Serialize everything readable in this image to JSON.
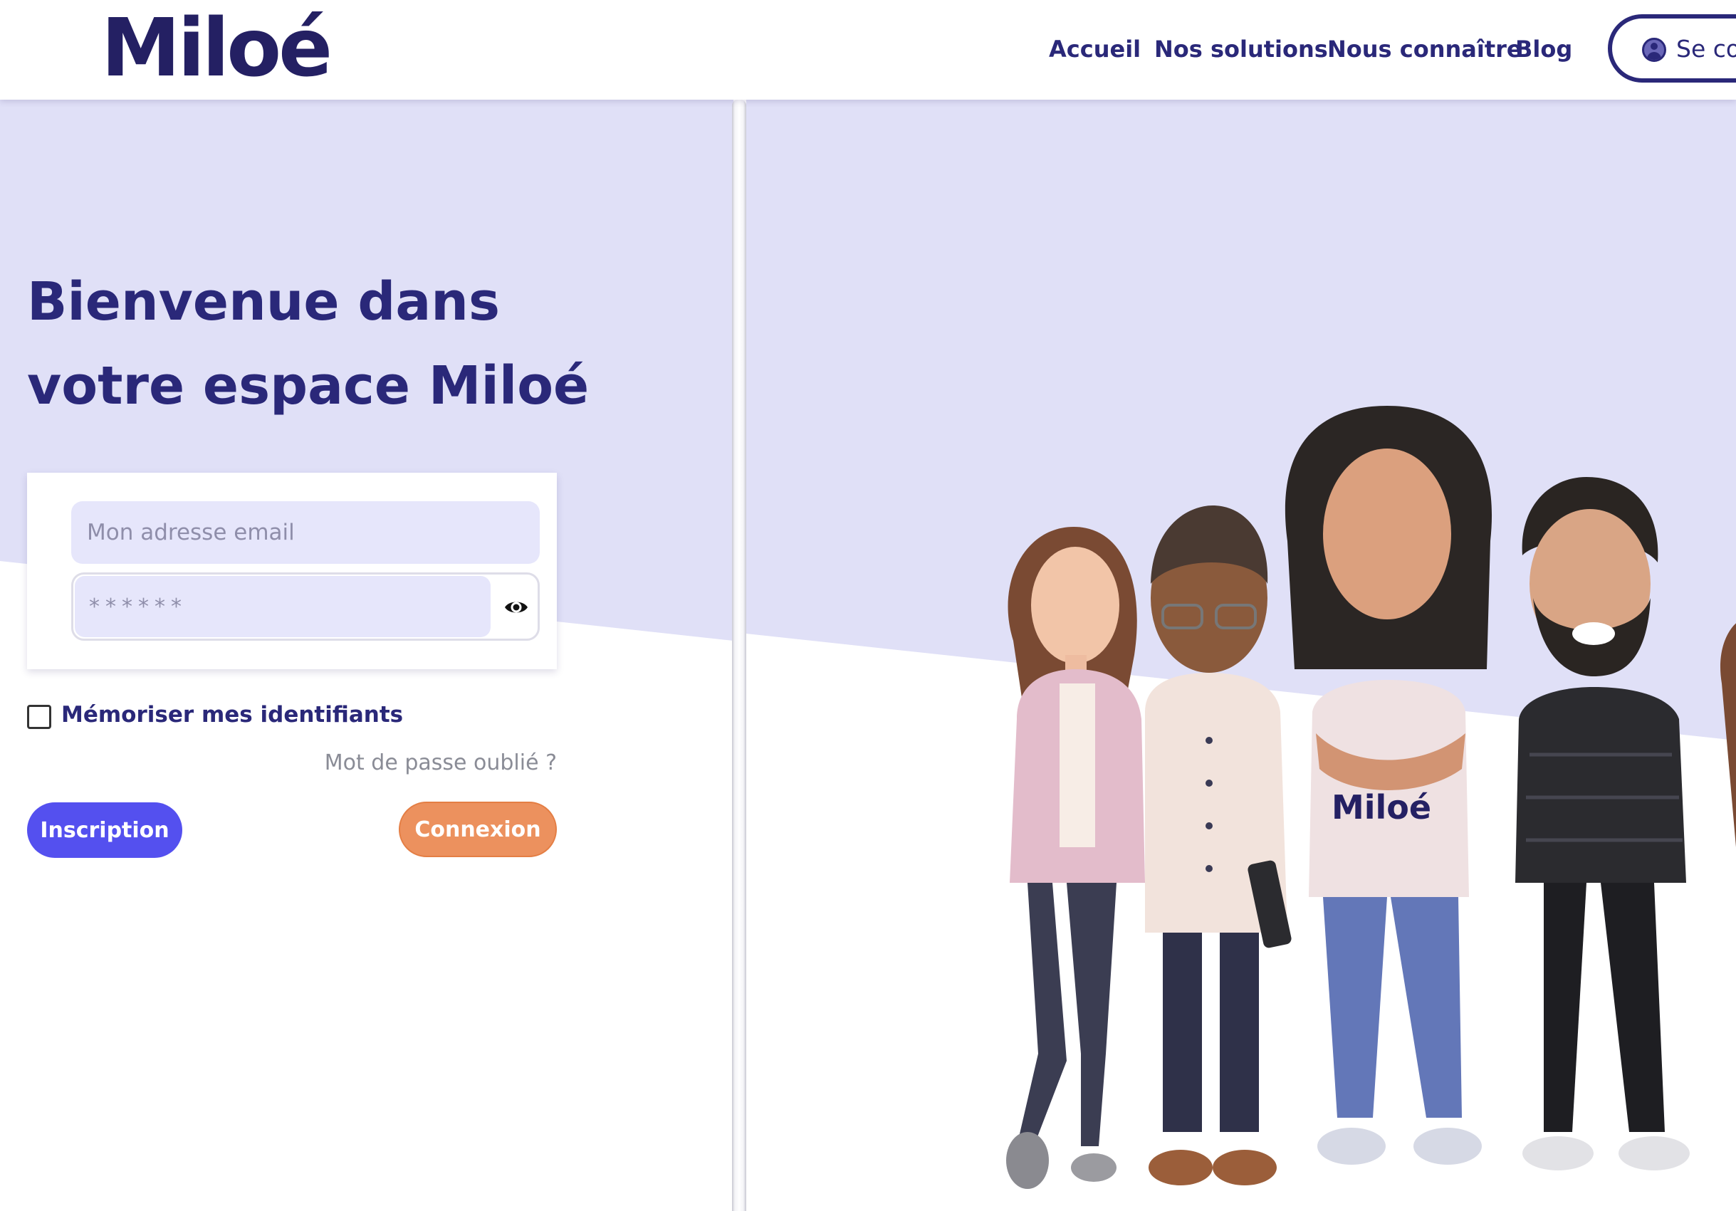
{
  "brand": {
    "logo_text": "Miloé"
  },
  "nav": {
    "items": [
      {
        "label": "Accueil"
      },
      {
        "label": "Nos solutions"
      },
      {
        "label": "Nous connaître"
      },
      {
        "label": "Blog"
      }
    ],
    "login_pill_label": "Se con"
  },
  "welcome": {
    "line1": "Bienvenue dans",
    "line2": "votre espace Miloé"
  },
  "form": {
    "email_placeholder": "Mon adresse email",
    "password_placeholder": "******",
    "remember_label": "Mémoriser mes identifiants",
    "remember_checked": false,
    "forgot_label": "Mot de passe oublié ?",
    "signup_label": "Inscription",
    "login_label": "Connexion"
  },
  "illustration": {
    "tshirt_text": "Miloé"
  },
  "colors": {
    "brand_dark": "#2a2879",
    "panel_lavender": "#e0e0f7",
    "input_bg": "#e6e6fb",
    "signup_blue": "#5450ef",
    "login_orange": "#ec915e"
  }
}
